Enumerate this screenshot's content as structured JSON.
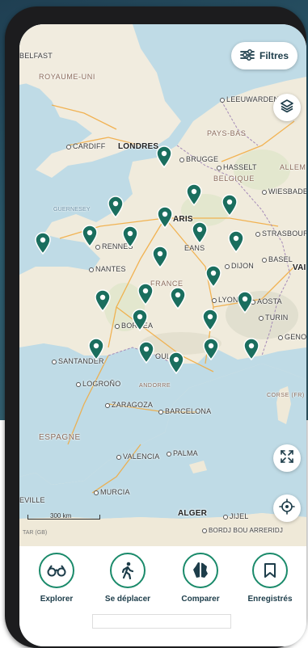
{
  "map": {
    "labels": {
      "belfast": "BELFAST",
      "royaume_uni": "ROYAUME-UNI",
      "cardiff": "CARDIFF",
      "londres": "LONDRES",
      "bruges": "BRUGGE",
      "hasselt": "HASSELT",
      "leeuwarden": "LEEUWARDEN",
      "pays_bas": "PAYS-BAS",
      "belgique": "BELGIQUE",
      "wiesbaden": "WIESBADEN",
      "allem": "ALLEM",
      "guernesey": "GUERNESEY",
      "paris": "ARIS",
      "rennes": "RENNES",
      "strasbourg": "STRASBOURG",
      "orleans": "EANS",
      "dijon": "DIJON",
      "basel": "BASEL",
      "vad": "VAI",
      "nantes": "NANTES",
      "france": "FRANCE",
      "lyon": "LYON",
      "aosta": "AOSTA",
      "turin": "TURIN",
      "bordeaux": "BORDEA",
      "genoa": "GENOA",
      "santander": "SANTANDER",
      "toulouse": "OULO",
      "andorre": "ANDORRE",
      "corse": "CORSE (FR)",
      "logrono": "LOGROÑO",
      "zaragoza": "ZARAGOZA",
      "barcelona": "BARCELONA",
      "espagne": "ESPAGNE",
      "valencia": "VALENCIA",
      "palma": "PALMA",
      "murcia": "MURCIA",
      "seville": "EVILLE",
      "alger": "ALGER",
      "jijel": "JIJEL",
      "bordj": "BORDJ BOU ARRERIDJ",
      "tar": "TAR (GB)"
    },
    "scale_label": "300 km"
  },
  "controls": {
    "filters_label": "Filtres"
  },
  "tabs": [
    {
      "label": "Explorer"
    },
    {
      "label": "Se déplacer"
    },
    {
      "label": "Comparer"
    },
    {
      "label": "Enregistrés"
    }
  ],
  "colors": {
    "pin": "#1a6e5e",
    "accent": "#1a8a6a",
    "text_dark": "#1d3d4a"
  }
}
